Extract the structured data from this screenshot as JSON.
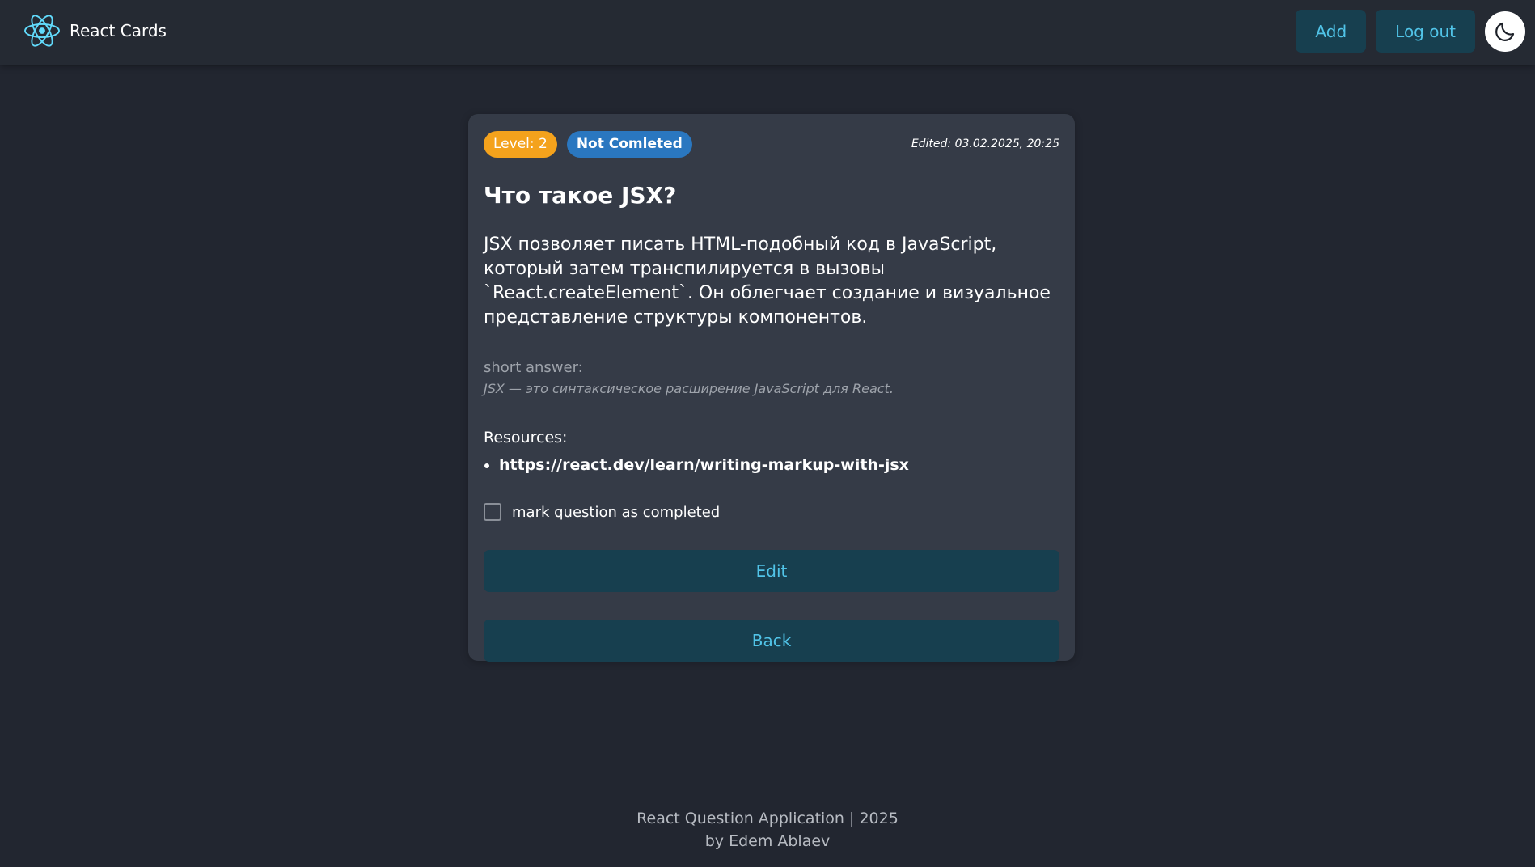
{
  "header": {
    "brand_name": "React Cards",
    "add_label": "Add",
    "logout_label": "Log out",
    "brand_icon": "react-logo-icon",
    "theme_icon": "moon-icon"
  },
  "card": {
    "level_badge": "Level: 2",
    "status_badge": "Not Comleted",
    "edited": "Edited: 03.02.2025, 20:25",
    "title": "Что такое JSX?",
    "description": "JSX позволяет писать HTML-подобный код в JavaScript, который затем транспилируется в вызовы `React.createElement`. Он облегчает создание и визуальное представление структуры компонентов.",
    "short_answer_label": "short answer:",
    "short_answer": "JSX — это синтаксическое расширение JavaScript для React.",
    "resources_label": "Resources:",
    "resources": [
      "https://react.dev/learn/writing-markup-with-jsx"
    ],
    "checkbox_label": "mark question as completed",
    "edit_label": "Edit",
    "back_label": "Back"
  },
  "footer": {
    "line1": "React Question Application | 2025",
    "line2": "by Edem Ablaev"
  },
  "colors": {
    "background": "#222630",
    "header": "#252a33",
    "card": "#353b47",
    "button_bg": "#173f4f",
    "button_text": "#51c4e8",
    "level_badge": "#f4a21c",
    "status_badge": "#2a77c0",
    "react_logo": "#61dafb"
  }
}
